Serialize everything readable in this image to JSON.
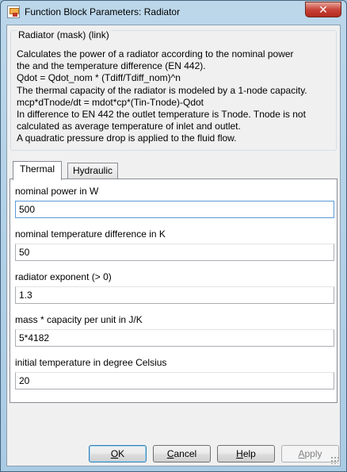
{
  "window": {
    "title": "Function Block Parameters: Radiator",
    "close_glyph": "✕"
  },
  "group": {
    "title": "Radiator (mask) (link)",
    "description": "Calculates the power of a radiator according to the nominal power\nthe and the temperature difference (EN 442).\nQdot = Qdot_nom * (Tdiff/Tdiff_nom)^n\nThe thermal capacity of the radiator is modeled by a 1-node capacity.\nmcp*dTnode/dt = mdot*cp*(Tin-Tnode)-Qdot\nIn difference to EN 442 the outlet temperature is Tnode. Tnode is not\ncalculated as average temperature of inlet and outlet.\nA quadratic pressure drop is applied to the fluid flow."
  },
  "tabs": [
    {
      "label": "Thermal",
      "active": true
    },
    {
      "label": "Hydraulic",
      "active": false
    }
  ],
  "parameters": [
    {
      "label": "nominal power in W",
      "value": "500"
    },
    {
      "label": "nominal temperature difference in K",
      "value": "50"
    },
    {
      "label": "radiator exponent (> 0)",
      "value": "1.3"
    },
    {
      "label": "mass * capacity per unit in J/K",
      "value": "5*4182"
    },
    {
      "label": "initial temperature in degree Celsius",
      "value": "20"
    }
  ],
  "buttons": {
    "ok": {
      "mnemonic": "O",
      "rest": "K"
    },
    "cancel": {
      "mnemonic": "C",
      "rest": "ancel"
    },
    "help": {
      "mnemonic": "H",
      "rest": "elp"
    },
    "apply": {
      "mnemonic": "A",
      "rest": "pply",
      "enabled": false
    }
  },
  "icons": [
    "app-icon",
    "close-icon",
    "resize-grip-icon"
  ]
}
